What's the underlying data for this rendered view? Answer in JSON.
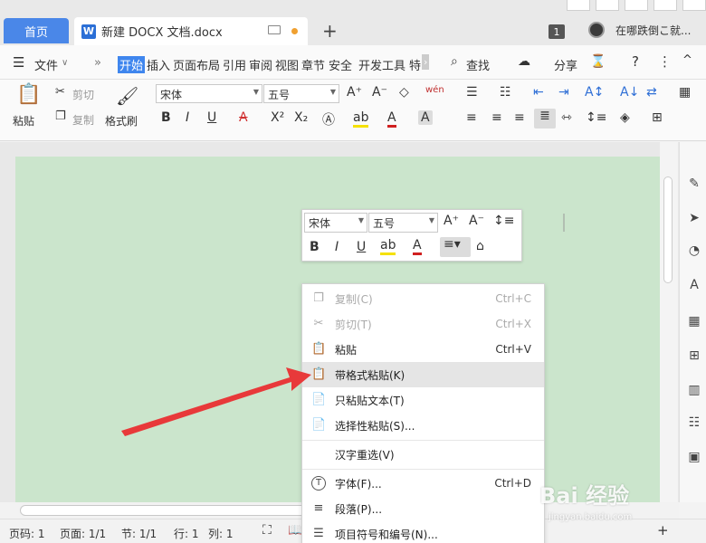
{
  "titlebar": {
    "home_tab": "首页",
    "doc_tab": "新建 DOCX 文档.docx",
    "add_tab": "+",
    "badge": "1",
    "username": "在哪跌倒こ就..."
  },
  "menubar": {
    "items": [
      "文件",
      "开始",
      "插入",
      "页面布局",
      "引用",
      "审阅",
      "视图",
      "章节",
      "安全",
      "开发工具",
      "特"
    ],
    "search": "查找",
    "share": "分享",
    "help": "?",
    "more": "⋮",
    "collapse": "^"
  },
  "ribbon": {
    "paste": "粘贴",
    "cut": "剪切",
    "copy": "复制",
    "format_painter": "格式刷",
    "font_family": "宋体",
    "font_size": "五号",
    "pinyin": "wén"
  },
  "minibar": {
    "font_family": "宋体",
    "font_size": "五号"
  },
  "context_menu": [
    {
      "icon": "copy-icon",
      "label": "复制(C)",
      "shortcut": "Ctrl+C",
      "disabled": true
    },
    {
      "icon": "scissors-icon",
      "label": "剪切(T)",
      "shortcut": "Ctrl+X",
      "disabled": true
    },
    {
      "icon": "clipboard-icon",
      "label": "粘贴",
      "shortcut": "Ctrl+V",
      "disabled": false
    },
    {
      "icon": "paste-format-icon",
      "label": "带格式粘贴(K)",
      "shortcut": "",
      "disabled": false,
      "hover": true
    },
    {
      "icon": "paste-text-icon",
      "label": "只粘贴文本(T)",
      "shortcut": "",
      "disabled": false
    },
    {
      "icon": "paste-special-icon",
      "label": "选择性粘贴(S)...",
      "shortcut": "",
      "disabled": false
    },
    {
      "icon": "",
      "label": "汉字重选(V)",
      "shortcut": "",
      "disabled": false
    },
    {
      "icon": "font-icon",
      "label": "字体(F)...",
      "shortcut": "Ctrl+D",
      "disabled": false
    },
    {
      "icon": "paragraph-icon",
      "label": "段落(P)...",
      "shortcut": "",
      "disabled": false
    },
    {
      "icon": "bullet-list-icon",
      "label": "项目符号和编号(N)...",
      "shortcut": "",
      "disabled": false
    }
  ],
  "statusbar": {
    "page_code": "页码: 1",
    "page": "页面: 1/1",
    "section": "节: 1/1",
    "line": "行: 1",
    "column": "列: 1"
  },
  "watermark": {
    "logo": "Bai 经验",
    "site": "jingyan.baidu.com"
  },
  "colors": {
    "accent": "#3f86ee",
    "page_bg": "#cbe5cc",
    "arrow": "#e8393a"
  }
}
